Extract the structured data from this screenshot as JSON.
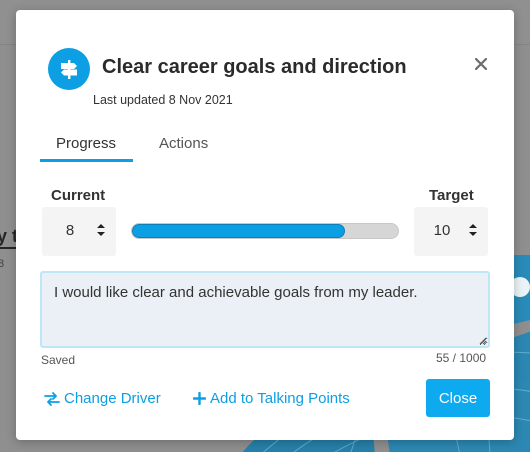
{
  "background": {
    "text_partial": "y t",
    "text_small": "8"
  },
  "dialog": {
    "title": "Clear career goals and direction",
    "subtitle": "Last updated 8 Nov 2021",
    "icon": "signpost-icon",
    "accent_color": "#0c9fe3"
  },
  "tabs": [
    {
      "label": "Progress",
      "active": true
    },
    {
      "label": "Actions",
      "active": false
    }
  ],
  "current": {
    "label": "Current",
    "value": "8"
  },
  "target": {
    "label": "Target",
    "value": "10"
  },
  "progress": {
    "value": 8,
    "max": 10,
    "fraction": 0.8
  },
  "comment": {
    "value": "I would like clear and achievable goals from my leader.",
    "status": "Saved",
    "counter": "55 / 1000"
  },
  "footer": {
    "change_driver": "Change Driver",
    "add_talking": "Add to Talking Points",
    "close": "Close"
  }
}
